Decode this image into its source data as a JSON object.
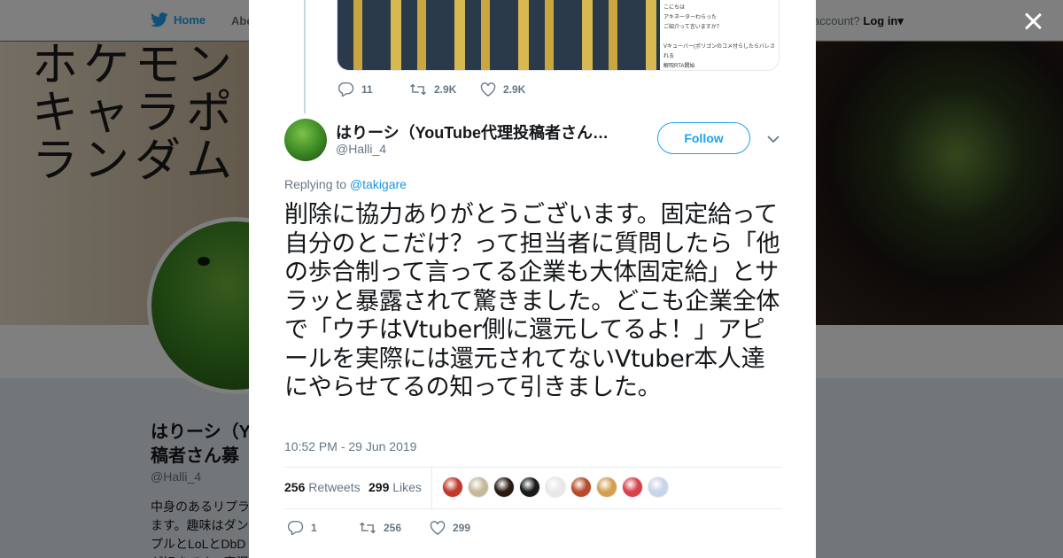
{
  "topnav": {
    "home_label": "Home",
    "about_label": "Abo",
    "account_prompt": "account?",
    "login_label": "Log in"
  },
  "background_profile": {
    "banner_text": "ホケモン\nキャラポ\nランダム",
    "name": "はりーシ（Y\n稿者さん募",
    "handle": "@Halli_4",
    "bio": "中身のあるリプラ\nます。趣味はダン\nプルとLoLとDbD\nが好きです。実況"
  },
  "modal": {
    "parent_tweet": {
      "media_caption": "こんばんは　素人Vtuberになると聞いて興\nこにちは\nアキネーターわらった\nご紹介って言いますか？\n\nVキューバー(ポリゴンのコメ付らしたらバレされる\n解呪RTA開始\nラングのゆっくりにゃん",
      "replies": "11",
      "retweets": "2.9K",
      "likes": "2.9K"
    },
    "tweet": {
      "author_name": "はりーシ（YouTube代理投稿者さん…",
      "author_handle": "@Halli_4",
      "follow_label": "Follow",
      "replying_label": "Replying to",
      "replying_to": "@takigare",
      "text": "削除に協力ありがとうございます。固定給って自分のとこだけ？って担当者に質問したら「他の歩合制って言ってる企業も大体固定給」とサラッと暴露されて驚きました。どこも企業全体で「ウチはVtuber側に還元してるよ！」アピールを実際には還元されてないVtuber本人達にやらせてるの知って引きました。",
      "timestamp": "10:52 PM - 29 Jun 2019",
      "retweets_count": "256",
      "retweets_label": "Retweets",
      "likes_count": "299",
      "likes_label": "Likes",
      "liker_avatars": [
        {
          "color": "#c0392b"
        },
        {
          "color": "#c8b89a"
        },
        {
          "color": "#2a1a12"
        },
        {
          "color": "#1a1a1a"
        },
        {
          "color": "#e8e8ea"
        },
        {
          "color": "#b84a2a"
        },
        {
          "color": "#d4a050"
        },
        {
          "color": "#d8404a"
        },
        {
          "color": "#c8d4e8"
        }
      ],
      "actions": {
        "replies": "1",
        "retweets": "256",
        "likes": "299"
      }
    }
  },
  "colors": {
    "accent": "#1da1f2",
    "mention": "#1b95e0",
    "secondary_text": "#657786"
  }
}
